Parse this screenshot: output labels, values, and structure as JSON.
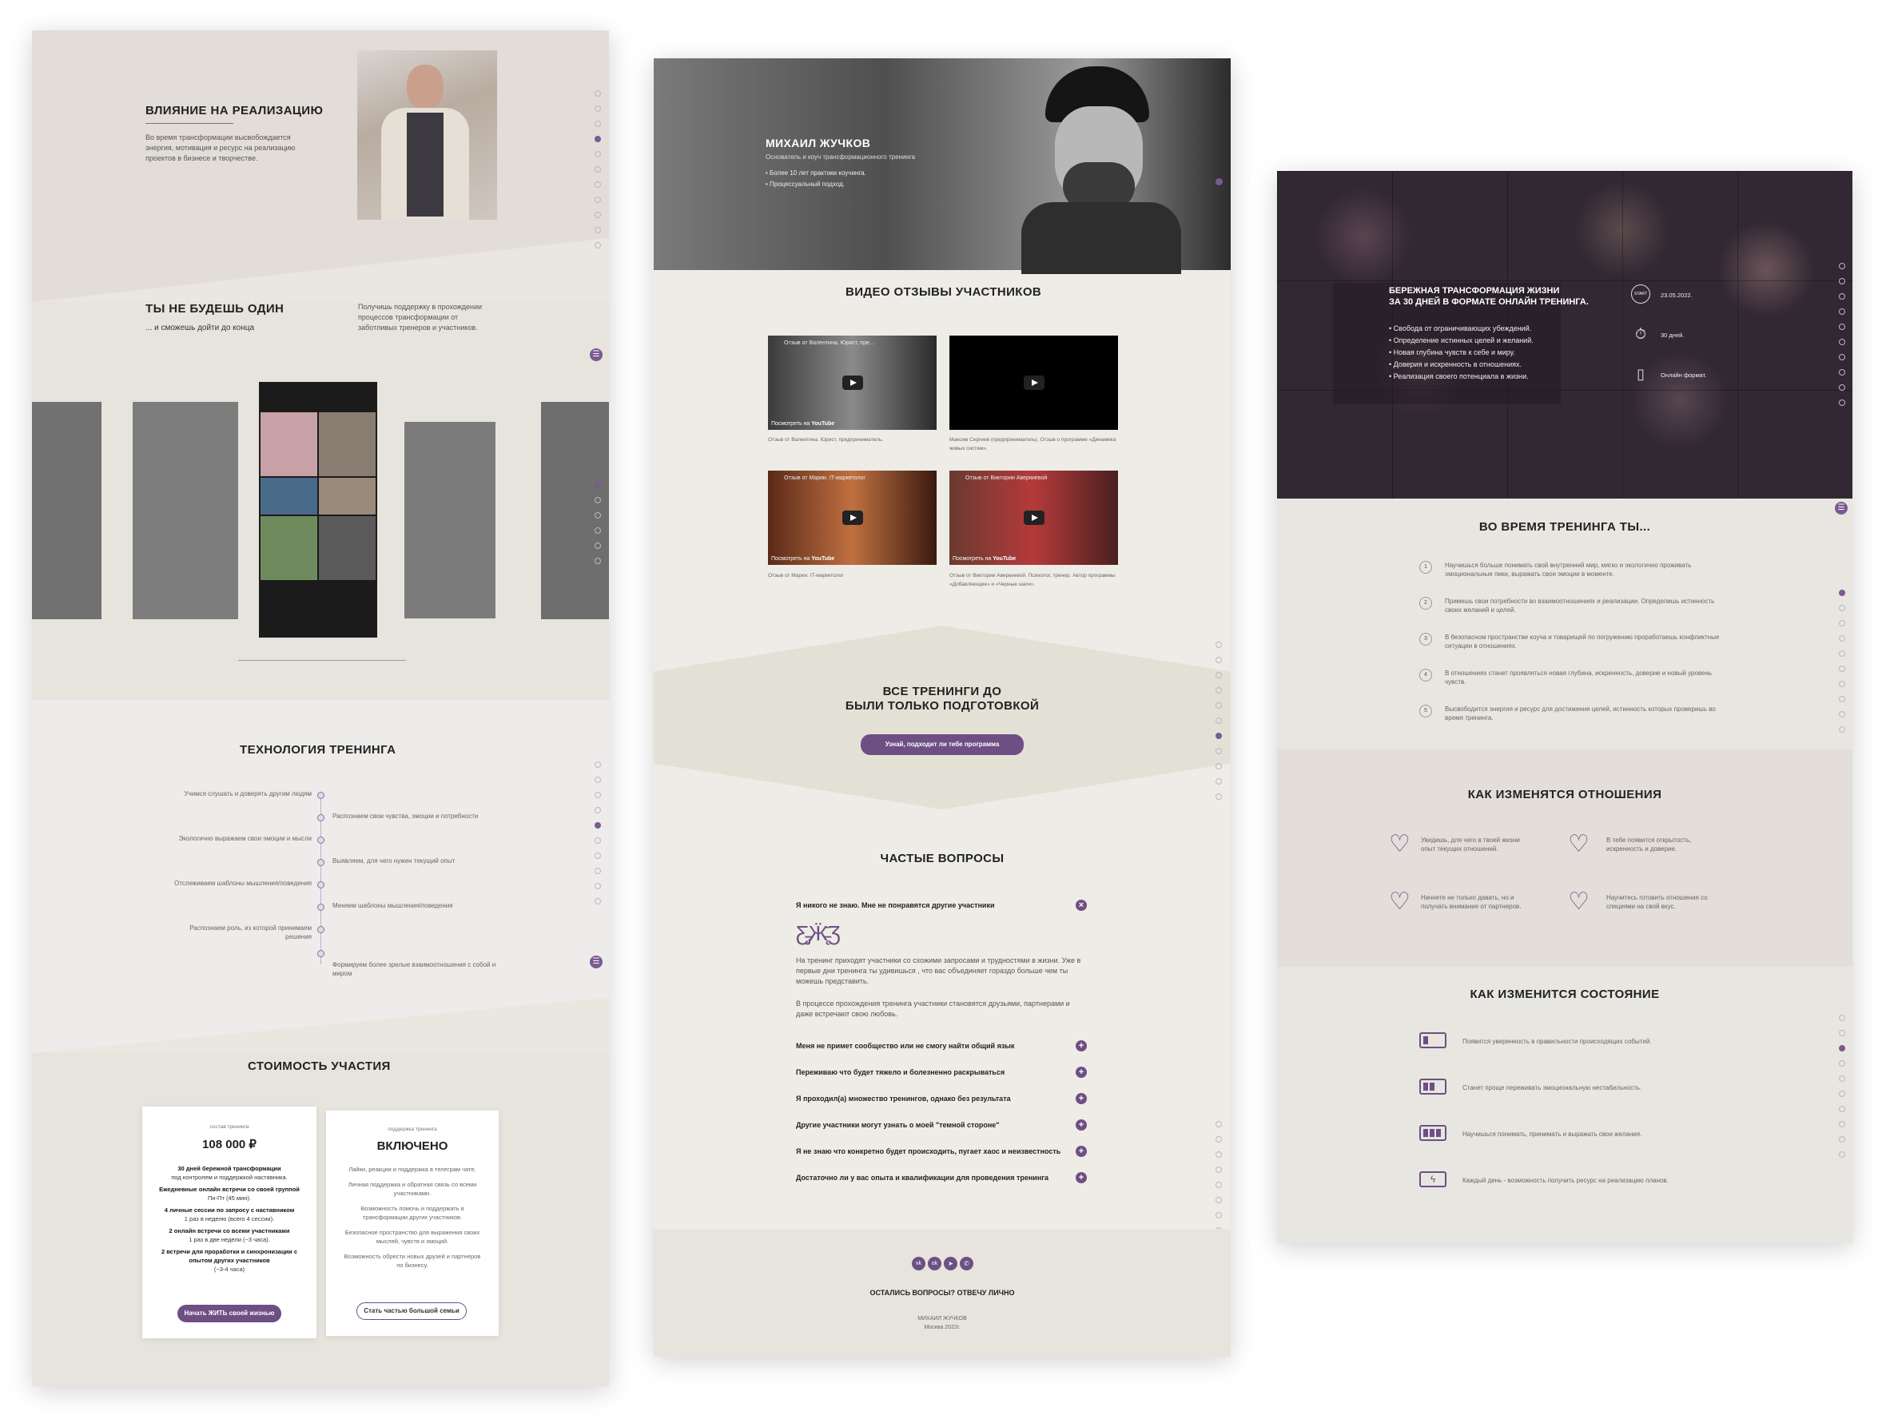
{
  "col1": {
    "influence": {
      "title": "ВЛИЯНИЕ НА РЕАЛИЗАЦИЮ",
      "text": "Во время трансформации высвобождается энергия, мотивация и ресурс на реализацию проектов в бизнесе и творчестве."
    },
    "not_alone": {
      "title": "ТЫ НЕ БУДЕШЬ ОДИН",
      "subtitle": "... и сможешь дойти до конца",
      "text": "Получишь поддержку в прохождении процессов трансформации от заботливых тренеров и участников."
    },
    "technology": {
      "title": "ТЕХНОЛОГИЯ ТРЕНИНГА",
      "left_items": [
        "Учимся слушать и доверять другим людям",
        "Экологично выражаем свои эмоции и мысли",
        "Отслеживаем шаблоны мышления/поведения",
        "Распознаем роль, из которой принимаем решения"
      ],
      "right_items": [
        "Распознаем свои чувства, эмоции и потребности",
        "Выявляем, для чего нужен текущий опыт",
        "Меняем шаблоны мышления/поведения",
        "Формируем более зрелые взаимоотношения с собой и миром"
      ]
    },
    "pricing": {
      "title": "СТОИМОСТЬ УЧАСТИЯ",
      "card1": {
        "caption": "состав тренинга",
        "price": "108 000 ₽",
        "items": [
          {
            "b": "30 дней бережной трансформации",
            "t": "под контролем и поддержкой наставника."
          },
          {
            "b": "Ежедневные онлайн встречи со своей группой",
            "t": "Пн-Пт (45 мин)."
          },
          {
            "b": "4 личные сессии по запросу с наставником",
            "t": "1 раз в неделю (всего 4 сессии)."
          },
          {
            "b": "2 онлайн встречи со всеми участниками",
            "t": "1 раз в две недели (~3 часа)."
          },
          {
            "b": "2 встречи для проработки и синхронизации с опытом других участников",
            "t": "(~3-4 часа)"
          }
        ],
        "button": "Начать ЖИТЬ своей жизнью"
      },
      "card2": {
        "caption": "поддержка тренинга",
        "title": "ВКЛЮЧЕНО",
        "items": [
          "Лайки, реакции и поддержка в телеграм чате.",
          "Личная поддержка и обратная связь со всеми участниками.",
          "Возможность помочь и поддержать в трансформации других участников.",
          "Безопасное пространство для выражения своих мыслей, чувств и эмоций.",
          "Возможность обрести новых друзей и партнеров по бизнесу."
        ],
        "button": "Стать частью большой семьи"
      }
    }
  },
  "col2": {
    "hero": {
      "name": "МИХАИЛ ЖУЧКОВ",
      "role": "Основатель и коуч трансформационного тренинга",
      "bullets": [
        "Более 10 лет практики коучинга.",
        "Процессуальный подход."
      ]
    },
    "videos": {
      "title": "ВИДЕО ОТЗЫВЫ УЧАСТНИКОВ",
      "watch_on": "Посмотреть на",
      "youtube": "YouTube",
      "items": [
        {
          "title": "Отзыв от Валентина. Юрист, пре...",
          "caption": "Отзыв от Валентина. Юрист, предприниматель."
        },
        {
          "title": "",
          "caption": "Максим Сергеев (предприниматель). Отзыв о программе «Динамика живых систем»."
        },
        {
          "title": "Отзыв от Марии. IT-маркетолог",
          "caption": "Отзыв от Марии. IT-маркетолог"
        },
        {
          "title": "Отзыв от Виктории Аверкиевой",
          "caption": "Отзыв от Виктории Аверкиевой. Психолог, тренер. Автор программы «Добавляющие» и «Черные шаги»."
        }
      ]
    },
    "cta": {
      "title_line1": "ВСЕ ТРЕНИНГИ ДО",
      "title_line2": "БЫЛИ ТОЛЬКО ПОДГОТОВКОЙ",
      "button": "Узнай, подходит ли тебе программа"
    },
    "faq": {
      "title": "ЧАСТЫЕ ВОПРОСЫ",
      "open_question": "Я никого не знаю. Мне не понравятся другие участники",
      "answer_p1": "На тренинг приходят участники со схожими запросами и трудностями в жизни. Уже в первые дни тренинга ты удивишься , что вас объединяет гораздо больше чем ты можешь представить.",
      "answer_p2": "В процессе прохождения тренинга участники становятся друзьями, партнерами и даже встречают свою любовь.",
      "questions": [
        "Меня не примет сообщество или не смогу найти общий язык",
        "Переживаю что будет тяжело и болезненно раскрываться",
        "Я проходил(а) множество тренингов, однако без результата",
        "Другие участники могут узнать о моей \"темной стороне\"",
        "Я не знаю что конкретно будет происходить, пугает хаос и неизвестность",
        "Достаточно ли у вас опыта и квалификации для проведения тренинга"
      ]
    },
    "footer": {
      "social": [
        "vk",
        "ok",
        "tg",
        "wa"
      ],
      "question": "ОСТАЛИСЬ ВОПРОСЫ? ОТВЕЧУ ЛИЧНО",
      "name": "МИХАИЛ ЖУЧКОВ",
      "place": "Москва 2022г."
    }
  },
  "col3": {
    "hero": {
      "title_line1": "БЕРЕЖНАЯ ТРАНСФОРМАЦИЯ ЖИЗНИ",
      "title_line2": "ЗА 30 ДНЕЙ В ФОРМАТЕ ОНЛАЙН ТРЕНИНГА.",
      "bullets": [
        "Свобода от ограничивающих убеждений.",
        "Определение истинных целей и желаний.",
        "Новая глубина чувств к себе и миру.",
        "Доверия и искренность в отношениях.",
        "Реализация своего потенциала в жизни."
      ],
      "start_label": "START",
      "date": "23.05.2022.",
      "duration": "30 дней.",
      "format": "Онлайн формат."
    },
    "during": {
      "title": "ВО ВРЕМЯ ТРЕНИНГА ТЫ...",
      "items": [
        {
          "n": "1",
          "t": "Научишься больше понимать свой внутренний мир, мягко и экологично проживать эмоциональные пики, выражать свои эмоции в моменте."
        },
        {
          "n": "2",
          "t": "Примешь свои потребности во взаимоотношениях и реализации. Определишь истинность своих желаний и целей."
        },
        {
          "n": "3",
          "t": "В безопасном пространстве коуча и товарищей по погружению проработаешь конфликтные ситуации в отношениях."
        },
        {
          "n": "4",
          "t": "В отношениях станет проявляться новая глубина, искренность, доверие и новый уровень чувств."
        },
        {
          "n": "5",
          "t": "Высвободится энергия и ресурс для достижения целей, истинность которых проверишь во время тренинга."
        }
      ]
    },
    "relations": {
      "title": "КАК ИЗМЕНЯТСЯ ОТНОШЕНИЯ",
      "items": [
        "Увидишь, для чего в твоей жизни опыт текущих отношений.",
        "В тебе появится открытость, искренность и доверие.",
        "Начнете не только давать, но и получать внимание от партнеров.",
        "Научитесь готовить отношения со специями на свой вкус."
      ]
    },
    "state": {
      "title": "КАК ИЗМЕНИТСЯ СОСТОЯНИЕ",
      "items": [
        "Появится уверенность в правильности происходящих событий.",
        "Станет проще переживать эмоциональную нестабильность.",
        "Научишься понимать, принимать и выражать свои желания.",
        "Каждый день - возможность получить ресурс на реализацию планов."
      ]
    }
  },
  "colors": {
    "accent": "#6e4f84",
    "bg_beige": "#e7e4dd",
    "dark_hero": "#2a2130"
  }
}
